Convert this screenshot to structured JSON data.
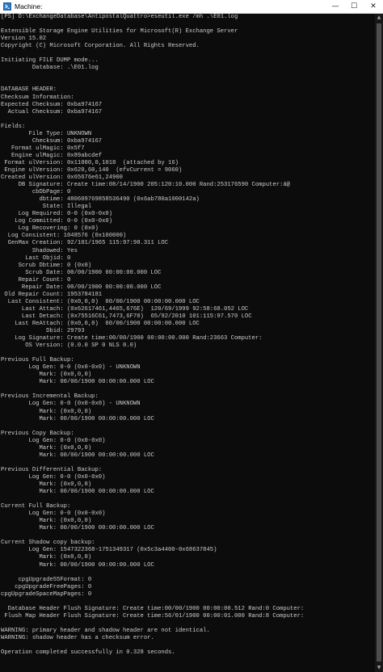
{
  "window": {
    "title": "Machine:",
    "minimize_glyph": "—",
    "maximize_glyph": "☐",
    "close_glyph": "✕",
    "colors": {
      "console_bg": "#0c0c0c",
      "console_text": "#cccccc",
      "titlebar_bg": "#ffffff"
    }
  },
  "console": {
    "lines": [
      "[PS] D:\\ExchangeDatabase\\AntipostalQuattro>eseutil.exe /mh .\\E01.log",
      "",
      "Extensible Storage Engine Utilities for Microsoft(R) Exchange Server",
      "Version 15.02",
      "Copyright (C) Microsoft Corporation. All Rights Reserved.",
      "",
      "Initiating FILE DUMP mode...",
      "         Database: .\\E01.log",
      "",
      "",
      "DATABASE HEADER:",
      "Checksum Information:",
      "Expected Checksum: 0xba974167",
      "  Actual Checksum: 0xba974167",
      "",
      "Fields:",
      "        File Type: UNKNOWN",
      "         Checksum: 0xba974167",
      "   Format ulMagic: 0x5f7",
      "   Engine ulMagic: 0x89abcdef",
      " Format ulVersion: 0x11000,0,1018  (attached by 16)",
      " Engine ulVersion: 0x620,60,140  (efvCurrent = 9060)",
      "Created ulVersion: 0x65676e61,24900",
      "     DB Signature: Create time:08/14/1900 205:120:10.000 Rand:253176590 Computer:á@",
      "         cbDbPage: 0",
      "           dbtime: 480609769858536490 (0x6ab780a1000142a)",
      "            State: Illegal",
      "     Log Required: 0-0 (0x0-0x0)",
      "    Log Committed: 0-0 (0x0-0x0)",
      "     Log Recovering: 0 (0x0)",
      "  Log Consistent: 1048576 (0x100000)",
      "  GenMax Creation: 92/101/1965 115:97:98.311 LOC",
      "         Shadowed: Yes",
      "       Last Objid: 0",
      "     Scrub Dbtime: 0 (0x0)",
      "       Scrub Date: 00/00/1900 00:00:00.000 LOC",
      "     Repair Count: 0",
      "      Repair Date: 00/00/1900 00:00:00.000 LOC",
      " Old Repair Count: 1953784181",
      "  Last Consistent: (0x0,0,0)  00/00/1900 00:00:00.000 LOC",
      "      Last Attach: (0x62617461,4465,676E)  120/69/1999 92:58:68.052 LOC",
      "      Last Detach: (0x75516C61,7473,6F70)  65/92/2010 101:115:97.570 LOC",
      "    Last ReAttach: (0x0,0,0)  00/00/1900 00:00:00.000 LOC",
      "             Dbid: 29793",
      "    Log Signature: Create time:00/00/1900 00:00:00.000 Rand:23663 Computer:",
      "       OS Version: (0.0.0 SP 0 NLS 0.0)",
      "",
      "Previous Full Backup:",
      "        Log Gen: 0-0 (0x0-0x0) - UNKNOWN",
      "           Mark: (0x0,0,0)",
      "           Mark: 00/00/1900 00:00:00.000 LOC",
      "",
      "Previous Incremental Backup:",
      "        Log Gen: 0-0 (0x0-0x0) - UNKNOWN",
      "           Mark: (0x0,0,0)",
      "           Mark: 00/00/1900 00:00:00.000 LOC",
      "",
      "Previous Copy Backup:",
      "        Log Gen: 0-0 (0x0-0x0)",
      "           Mark: (0x0,0,0)",
      "           Mark: 00/00/1900 00:00:00.000 LOC",
      "",
      "Previous Differential Backup:",
      "        Log Gen: 0-0 (0x0-0x0)",
      "           Mark: (0x0,0,0)",
      "           Mark: 00/00/1900 00:00:00.000 LOC",
      "",
      "Current Full Backup:",
      "        Log Gen: 0-0 (0x0-0x0)",
      "           Mark: (0x0,0,0)",
      "           Mark: 00/00/1900 00:00:00.000 LOC",
      "",
      "Current Shadow copy backup:",
      "        Log Gen: 1547322368-1751349317 (0x5c3a4400-0x68637845)",
      "           Mark: (0x0,0,0)",
      "           Mark: 00/00/1900 00:00:00.000 LOC",
      "",
      "     cpgUpgrade55Format: 0",
      "    cpgUpgradeFreePages: 0",
      "cpgUpgradeSpaceMapPages: 0",
      "",
      "  Database Header Flush Signature: Create time:00/00/1900 00:00:00.512 Rand:0 Computer:",
      " Flush Map Header Flush Signature: Create time:56/01/1900 00:00:01.000 Rand:8 Computer:",
      "",
      "WARNING: primary header and shadow header are not identical.",
      "WARNING: shadow header has a checksum error.",
      "",
      "Operation completed successfully in 0.328 seconds.",
      ""
    ]
  },
  "scrollbar": {
    "up_glyph": "▲",
    "down_glyph": "▼"
  }
}
